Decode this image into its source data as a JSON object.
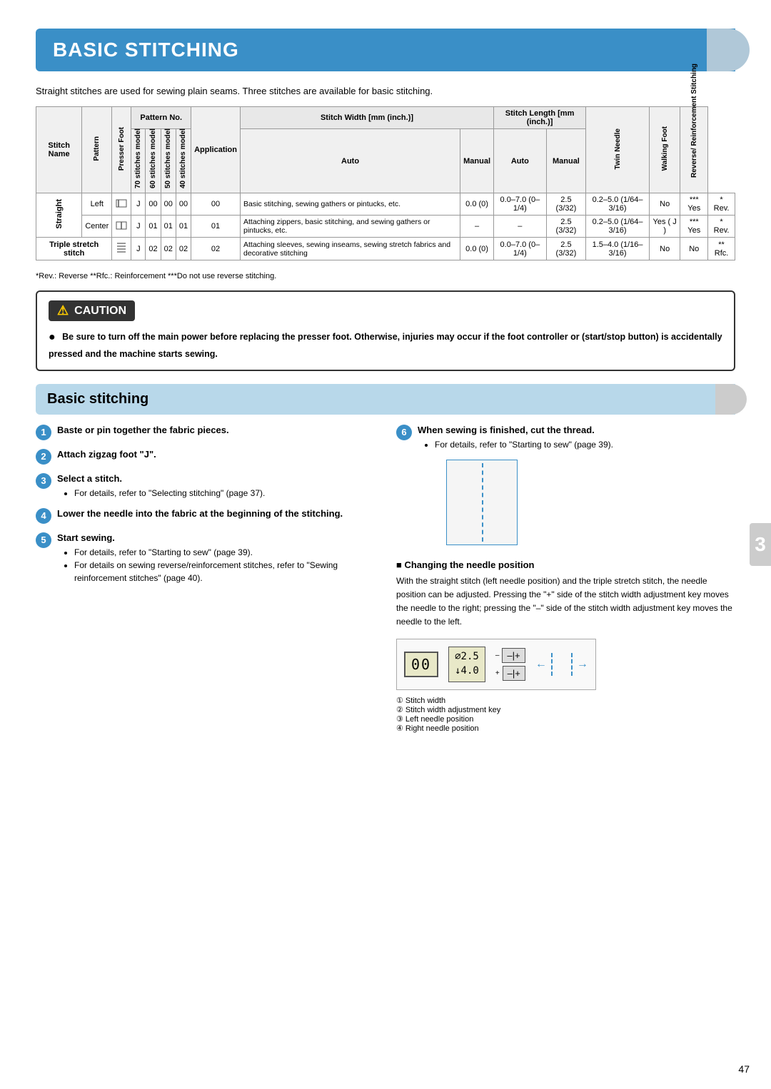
{
  "page": {
    "header": "BASIC STITCHING",
    "intro": "Straight stitches are used for sewing plain seams. Three stitches are available for basic stitching.",
    "page_number": "47",
    "side_tab": "3"
  },
  "table": {
    "headers": {
      "stitch_name": "Stitch Name",
      "pattern": "Pattern",
      "presser_foot": "Presser Foot",
      "pattern_no": "Pattern No.",
      "col_70": "70 stitches model",
      "col_60": "60 stitches model",
      "col_50": "50 stitches model",
      "col_40": "40 stitches model",
      "application": "Application",
      "stitch_width": "Stitch Width [mm (inch.)]",
      "stitch_width_auto": "Auto",
      "stitch_width_manual": "Manual",
      "stitch_length": "Stitch Length [mm (inch.)]",
      "stitch_length_auto": "Auto",
      "stitch_length_manual": "Manual",
      "twin_needle": "Twin Needle",
      "walking_foot": "Walking Foot",
      "reverse": "Reverse/ Reinforcement Stitching"
    },
    "rows": [
      {
        "group": "Straight",
        "name": "Left",
        "pattern_icon": "presser-foot-left",
        "foot": "J",
        "c70": "00",
        "c60": "00",
        "c50": "00",
        "c40": "00",
        "application": "Basic stitching, sewing gathers or pintucks, etc.",
        "sw_auto": "0.0 (0)",
        "sw_manual": "0.0–7.0 (0–1/4)",
        "sl_auto": "2.5 (3/32)",
        "sl_manual": "0.2–5.0 (1/64–3/16)",
        "twin": "No",
        "walking": "*** Yes",
        "reverse": "* Rev."
      },
      {
        "group": "Straight",
        "name": "Center",
        "pattern_icon": "presser-foot-center",
        "foot": "J",
        "c70": "01",
        "c60": "01",
        "c50": "01",
        "c40": "01",
        "application": "Attaching zippers, basic stitching, and sewing gathers or pintucks, etc.",
        "sw_auto": "–",
        "sw_manual": "–",
        "sl_auto": "2.5 (3/32)",
        "sl_manual": "0.2–5.0 (1/64–3/16)",
        "twin": "Yes ( J )",
        "walking": "*** Yes",
        "reverse": "* Rev."
      },
      {
        "group": "Triple stretch stitch",
        "name": "Triple stretch stitch",
        "pattern_icon": "triple-stretch",
        "foot": "J",
        "c70": "02",
        "c60": "02",
        "c50": "02",
        "c40": "02",
        "application": "Attaching sleeves, sewing inseams, sewing stretch fabrics and decorative stitching",
        "sw_auto": "0.0 (0)",
        "sw_manual": "0.0–7.0 (0–1/4)",
        "sl_auto": "2.5 (3/32)",
        "sl_manual": "1.5–4.0 (1/16–3/16)",
        "twin": "No",
        "walking": "No",
        "reverse": "** Rfc."
      }
    ],
    "footnotes": "*Rev.: Reverse   **Rfc.: Reinforcement   ***Do not use reverse stitching."
  },
  "caution": {
    "title": "CAUTION",
    "text": "Be sure to turn off the main power before replacing the presser foot. Otherwise, injuries may occur if the foot controller or (start/stop button) is accidentally pressed and the machine starts sewing."
  },
  "section": {
    "title": "Basic stitching",
    "steps": [
      {
        "num": "1",
        "title": "Baste or pin together the fabric pieces.",
        "bullets": []
      },
      {
        "num": "2",
        "title": "Attach zigzag foot \"J\".",
        "bullets": []
      },
      {
        "num": "3",
        "title": "Select a stitch.",
        "bullets": [
          "For details, refer to \"Selecting stitching\" (page 37)."
        ]
      },
      {
        "num": "4",
        "title": "Lower the needle into the fabric at the beginning of the stitching.",
        "bullets": []
      },
      {
        "num": "5",
        "title": "Start sewing.",
        "bullets": [
          "For details, refer to \"Starting to sew\" (page 39).",
          "For details on sewing reverse/reinforcement stitches, refer to \"Sewing reinforcement stitches\" (page 40)."
        ]
      }
    ],
    "step6": {
      "num": "6",
      "title": "When sewing is finished, cut the thread.",
      "bullets": [
        "For details, refer to \"Starting to sew\" (page 39)."
      ]
    },
    "changing_needle": {
      "title": "Changing the needle position",
      "text": "With the straight stitch (left needle position) and the triple stretch stitch, the needle position can be adjusted. Pressing the \"+\" side of the stitch width adjustment key moves the needle to the right; pressing the \"–\" side of the stitch width adjustment key moves the needle to the left."
    },
    "diagram_labels": [
      "① Stitch width",
      "② Stitch width adjustment key",
      "③ Left needle position",
      "④ Right needle position"
    ]
  }
}
